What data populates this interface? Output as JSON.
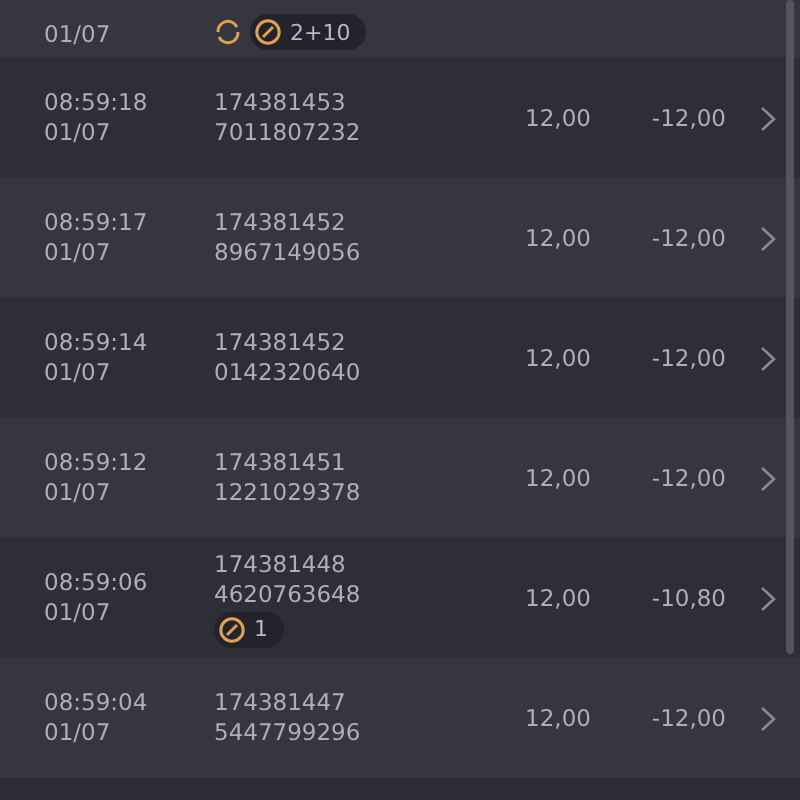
{
  "top_row": {
    "date": "01/07",
    "badges": [
      {
        "kind": "refresh"
      },
      {
        "kind": "pill",
        "text": "2+10"
      }
    ]
  },
  "rows": [
    {
      "time": "08:59:18",
      "date": "01/07",
      "ids": [
        "174381453",
        "7011807232"
      ],
      "stake": "12,00",
      "result": "-12,00",
      "badges": []
    },
    {
      "time": "08:59:17",
      "date": "01/07",
      "ids": [
        "174381452",
        "8967149056"
      ],
      "stake": "12,00",
      "result": "-12,00",
      "badges": []
    },
    {
      "time": "08:59:14",
      "date": "01/07",
      "ids": [
        "174381452",
        "0142320640"
      ],
      "stake": "12,00",
      "result": "-12,00",
      "badges": []
    },
    {
      "time": "08:59:12",
      "date": "01/07",
      "ids": [
        "174381451",
        "1221029378"
      ],
      "stake": "12,00",
      "result": "-12,00",
      "badges": []
    },
    {
      "time": "08:59:06",
      "date": "01/07",
      "ids": [
        "174381448",
        "4620763648"
      ],
      "stake": "12,00",
      "result": "-10,80",
      "badges": [
        {
          "kind": "pill",
          "text": "1"
        }
      ]
    },
    {
      "time": "08:59:04",
      "date": "01/07",
      "ids": [
        "174381447",
        "5447799296"
      ],
      "stake": "12,00",
      "result": "-12,00",
      "badges": []
    }
  ]
}
